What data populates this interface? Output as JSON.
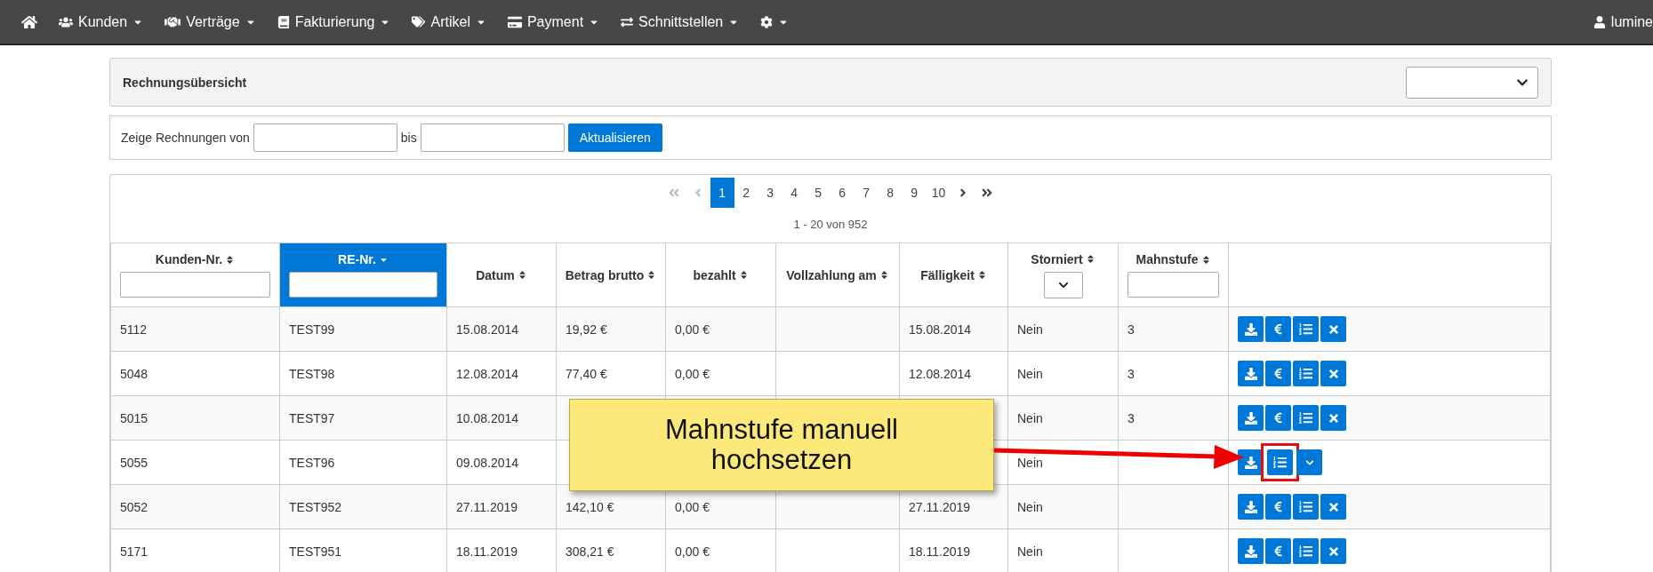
{
  "nav": {
    "items": [
      {
        "kind": "home",
        "dropdown": false
      },
      {
        "kind": "users",
        "label": "Kunden",
        "dropdown": true
      },
      {
        "kind": "handshake",
        "label": "Verträge",
        "dropdown": true
      },
      {
        "kind": "book",
        "label": "Fakturierung",
        "dropdown": true
      },
      {
        "kind": "tags",
        "label": "Artikel",
        "dropdown": true
      },
      {
        "kind": "card",
        "label": "Payment",
        "dropdown": true
      },
      {
        "kind": "exchange",
        "label": "Schnittstellen",
        "dropdown": true
      },
      {
        "kind": "settings",
        "dropdown": true
      }
    ],
    "user": "lumine"
  },
  "header": {
    "title": "Rechnungsübersicht"
  },
  "filter": {
    "from_label": "Zeige Rechnungen von",
    "to_label": "bis",
    "button": "Aktualisieren"
  },
  "pagination": {
    "items": [
      {
        "kind": "first",
        "disabled": true,
        "selected": false
      },
      {
        "kind": "prev",
        "disabled": true,
        "selected": false
      },
      {
        "kind": "page",
        "label": "1",
        "disabled": false,
        "selected": true
      },
      {
        "kind": "page",
        "label": "2",
        "disabled": false,
        "selected": false
      },
      {
        "kind": "page",
        "label": "3",
        "disabled": false,
        "selected": false
      },
      {
        "kind": "page",
        "label": "4",
        "disabled": false,
        "selected": false
      },
      {
        "kind": "page",
        "label": "5",
        "disabled": false,
        "selected": false
      },
      {
        "kind": "page",
        "label": "6",
        "disabled": false,
        "selected": false
      },
      {
        "kind": "page",
        "label": "7",
        "disabled": false,
        "selected": false
      },
      {
        "kind": "page",
        "label": "8",
        "disabled": false,
        "selected": false
      },
      {
        "kind": "page",
        "label": "9",
        "disabled": false,
        "selected": false
      },
      {
        "kind": "page",
        "label": "10",
        "disabled": false,
        "selected": false
      },
      {
        "kind": "next",
        "disabled": false,
        "selected": false
      },
      {
        "kind": "last",
        "disabled": false,
        "selected": false
      }
    ],
    "summary": "1 - 20 von 952"
  },
  "table": {
    "columns": [
      {
        "label": "Kunden-Nr.",
        "kind": "input",
        "selected": false
      },
      {
        "label": "RE-Nr.",
        "kind": "input",
        "selected": true
      },
      {
        "label": "Datum",
        "kind": "plain",
        "selected": false
      },
      {
        "label": "Betrag brutto",
        "kind": "plain",
        "selected": false
      },
      {
        "label": "bezahlt",
        "kind": "plain",
        "selected": false
      },
      {
        "label": "Vollzahlung am",
        "kind": "plain",
        "selected": false
      },
      {
        "label": "Fälligkeit",
        "kind": "plain",
        "selected": false
      },
      {
        "label": "Storniert",
        "kind": "select",
        "selected": false
      },
      {
        "label": "Mahnstufe",
        "kind": "input",
        "selected": false
      }
    ],
    "rows": [
      {
        "cells": [
          "5112",
          "TEST99",
          "15.08.2014",
          "19,92 €",
          "0,00 €",
          null,
          "15.08.2014",
          "Nein",
          "3"
        ],
        "actions": [
          {
            "kind": "download",
            "highlighted": false
          },
          {
            "kind": "euro",
            "highlighted": false
          },
          {
            "kind": "list",
            "highlighted": false
          },
          {
            "kind": "delete",
            "highlighted": false
          }
        ]
      },
      {
        "cells": [
          "5048",
          "TEST98",
          "12.08.2014",
          "77,40 €",
          "0,00 €",
          null,
          "12.08.2014",
          "Nein",
          "3"
        ],
        "actions": [
          {
            "kind": "download",
            "highlighted": false
          },
          {
            "kind": "euro",
            "highlighted": false
          },
          {
            "kind": "list",
            "highlighted": false
          },
          {
            "kind": "delete",
            "highlighted": false
          }
        ]
      },
      {
        "cells": [
          "5015",
          "TEST97",
          "10.08.2014",
          null,
          null,
          null,
          null,
          "Nein",
          "3"
        ],
        "actions": [
          {
            "kind": "download",
            "highlighted": false
          },
          {
            "kind": "euro",
            "highlighted": false
          },
          {
            "kind": "list",
            "highlighted": false
          },
          {
            "kind": "delete",
            "highlighted": false
          }
        ]
      },
      {
        "cells": [
          "5055",
          "TEST96",
          "09.08.2014",
          null,
          null,
          null,
          null,
          "Nein",
          null
        ],
        "actions": [
          {
            "kind": "download",
            "highlighted": false
          },
          {
            "kind": "list",
            "highlighted": true
          },
          {
            "kind": "dropdown",
            "highlighted": false
          }
        ]
      },
      {
        "cells": [
          "5052",
          "TEST952",
          "27.11.2019",
          "142,10 €",
          "0,00 €",
          null,
          "27.11.2019",
          "Nein",
          null
        ],
        "actions": [
          {
            "kind": "download",
            "highlighted": false
          },
          {
            "kind": "euro",
            "highlighted": false
          },
          {
            "kind": "list",
            "highlighted": false
          },
          {
            "kind": "delete",
            "highlighted": false
          }
        ]
      },
      {
        "cells": [
          "5171",
          "TEST951",
          "18.11.2019",
          "308,21 €",
          "0,00 €",
          null,
          "18.11.2019",
          "Nein",
          null
        ],
        "actions": [
          {
            "kind": "download",
            "highlighted": false
          },
          {
            "kind": "euro",
            "highlighted": false
          },
          {
            "kind": "list",
            "highlighted": false
          },
          {
            "kind": "delete",
            "highlighted": false
          }
        ]
      }
    ]
  },
  "callout": {
    "text": "Mahnstufe manuell hochsetzen"
  }
}
